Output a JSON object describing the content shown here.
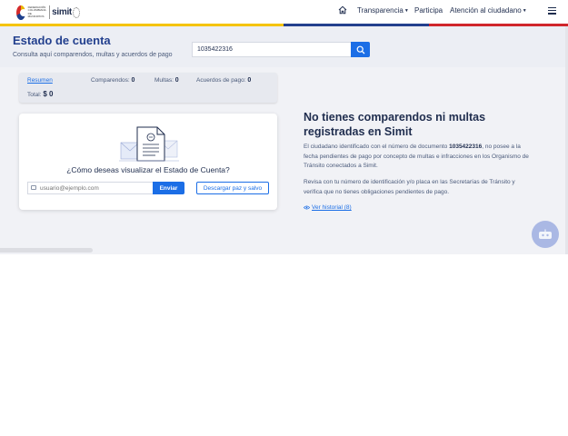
{
  "header": {
    "logo_fed_text": "FEDERACIÓN COLOMBIANA DE MUNICIPIOS",
    "logo_simit_text": "simit",
    "nav": [
      {
        "label": "Transparencia",
        "has_caret": true
      },
      {
        "label": "Participa",
        "has_caret": false
      },
      {
        "label": "Atención al ciudadano",
        "has_caret": true
      }
    ],
    "icons": {
      "home": "home-icon",
      "menu": "hamburger-menu-icon"
    },
    "flag_colors": [
      "#f5c400",
      "#23408e",
      "#d0262b"
    ]
  },
  "page": {
    "title": "Estado de cuenta",
    "subtitle": "Consulta aquí comparendos, multas y acuerdos de pago"
  },
  "search": {
    "value": "1035422316",
    "icon": "search-icon"
  },
  "summary": {
    "resumen_label": "Resumen",
    "comparendos_label": "Comparendos:",
    "comparendos_value": "0",
    "multas_label": "Multas:",
    "multas_value": "0",
    "acuerdos_label": "Acuerdos de pago:",
    "acuerdos_value": "0",
    "total_label": "Total:",
    "total_value": "$ 0"
  },
  "card": {
    "question": "¿Cómo deseas visualizar el Estado de Cuenta?",
    "email_placeholder": "usuario@ejemplo.com",
    "send_label": "Enviar",
    "paz_label": "Descargar paz y salvo"
  },
  "result": {
    "title": "No tienes comparendos ni multas registradas en Simit",
    "p1_before": "El ciudadano identificado con el número de documento ",
    "p1_doc": "1035422316",
    "p1_after": ", no posee a la fecha pendientes de pago por concepto de multas e infracciones en los Organismo de Tránsito conectados a Simit.",
    "p2": "Revisa con tu número de identificación y/o placa en las Secretarías de Tránsito y verifica que no tienes obligaciones pendientes de pago.",
    "historial_label": "Ver historial (8)"
  },
  "colors": {
    "primary": "#1b6ee6",
    "title_blue": "#23408e",
    "text_dark": "#1f2d4e",
    "band_bg": "#f1f2f6"
  }
}
